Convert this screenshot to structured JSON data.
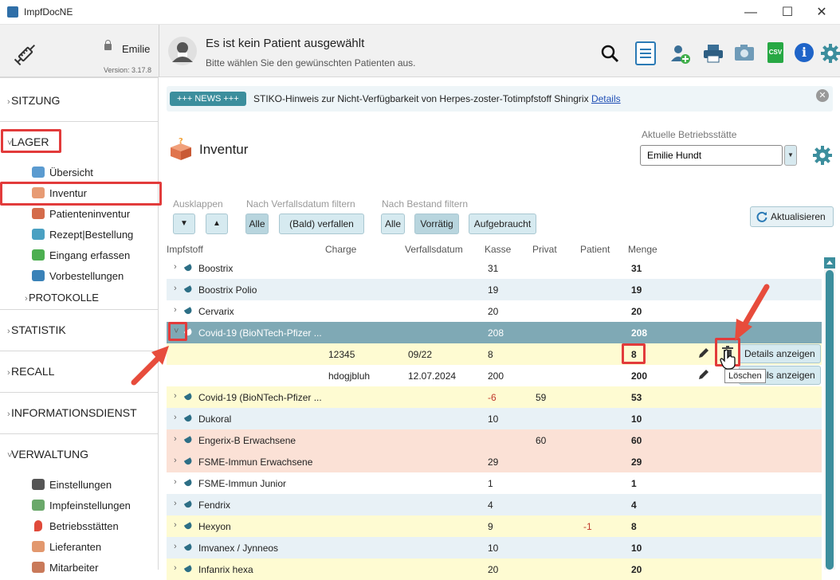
{
  "window": {
    "title": "ImpfDocNE",
    "minimize": "—",
    "maximize": "☐",
    "close": "✕"
  },
  "header": {
    "user": "Emilie",
    "version": "Version: 3.17.8",
    "patient_title": "Es ist kein Patient ausgewählt",
    "patient_subtitle": "Bitte wählen Sie den gewünschten Patienten aus.",
    "icons": [
      "search-icon",
      "document-icon",
      "add-patient-icon",
      "printer-icon",
      "camera-icon",
      "csv-icon",
      "info-icon",
      "gear-icon"
    ],
    "csv_label": "CSV",
    "info_label": "i"
  },
  "sidebar": {
    "sitzung": "SITZUNG",
    "lager": "LAGER",
    "lager_items": [
      "Übersicht",
      "Inventur",
      "Patienteninventur",
      "Rezept|Bestellung",
      "Eingang erfassen",
      "Vorbestellungen"
    ],
    "protokolle": "PROTOKOLLE",
    "statistik": "STATISTIK",
    "recall": "RECALL",
    "informationsdienst": "INFORMATIONSDIENST",
    "verwaltung": "VERWALTUNG",
    "verwaltung_items": [
      "Einstellungen",
      "Impfeinstellungen",
      "Betriebsstätten",
      "Lieferanten",
      "Mitarbeiter"
    ]
  },
  "news": {
    "badge": "+++ NEWS +++",
    "text": "STIKO-Hinweis zur Nicht-Verfügbarkeit von Herpes-zoster-Totimpfstoff Shingrix",
    "link": "Details",
    "close": "✕"
  },
  "page": {
    "title": "Inventur",
    "betriebsstaette_label": "Aktuelle Betriebsstätte",
    "betriebsstaette_value": "Emilie Hundt"
  },
  "filters": {
    "ausklappen": "Ausklappen",
    "verfall_label": "Nach Verfallsdatum filtern",
    "verfall_alle": "Alle",
    "verfall_bald": "(Bald) verfallen",
    "bestand_label": "Nach Bestand filtern",
    "bestand_alle": "Alle",
    "bestand_vorraetig": "Vorrätig",
    "bestand_aufgebraucht": "Aufgebraucht",
    "refresh": "Aktualisieren"
  },
  "columns": {
    "impfstoff": "Impfstoff",
    "charge": "Charge",
    "verfall": "Verfallsdatum",
    "kasse": "Kasse",
    "privat": "Privat",
    "patient": "Patient",
    "menge": "Menge"
  },
  "rows": [
    {
      "name": "Boostrix",
      "kasse": "31",
      "privat": "",
      "patient": "",
      "menge": "31",
      "bg": "#ffffff"
    },
    {
      "name": "Boostrix Polio",
      "kasse": "19",
      "privat": "",
      "patient": "",
      "menge": "19",
      "bg": "#e8f1f6"
    },
    {
      "name": "Cervarix",
      "kasse": "20",
      "privat": "",
      "patient": "",
      "menge": "20",
      "bg": "#ffffff"
    },
    {
      "name": "Covid-19 (BioNTech-Pfizer ...",
      "kasse": "208",
      "privat": "",
      "patient": "",
      "menge": "208",
      "bg": "#7fa9b5",
      "expanded": true
    },
    {
      "charge": "12345",
      "verfall": "09/22",
      "kasse": "8",
      "menge": "8",
      "bg": "#fefbd2",
      "sub": true,
      "details": "Details anzeigen"
    },
    {
      "charge": "hdogjbluh",
      "verfall": "12.07.2024",
      "kasse": "200",
      "menge": "200",
      "bg": "#ffffff",
      "sub": true,
      "details": "Details anzeigen"
    },
    {
      "name": "Covid-19 (BioNTech-Pfizer ...",
      "kasse": "-6",
      "privat": "59",
      "patient": "",
      "menge": "53",
      "bg": "#fefbd2"
    },
    {
      "name": "Dukoral",
      "kasse": "10",
      "privat": "",
      "patient": "",
      "menge": "10",
      "bg": "#e8f1f6"
    },
    {
      "name": "Engerix-B Erwachsene",
      "kasse": "",
      "privat": "60",
      "patient": "",
      "menge": "60",
      "bg": "#fbe1d6"
    },
    {
      "name": "FSME-Immun Erwachsene",
      "kasse": "29",
      "privat": "",
      "patient": "",
      "menge": "29",
      "bg": "#fbe1d6"
    },
    {
      "name": "FSME-Immun Junior",
      "kasse": "1",
      "privat": "",
      "patient": "",
      "menge": "1",
      "bg": "#ffffff"
    },
    {
      "name": "Fendrix",
      "kasse": "4",
      "privat": "",
      "patient": "",
      "menge": "4",
      "bg": "#e8f1f6"
    },
    {
      "name": "Hexyon",
      "kasse": "9",
      "privat": "",
      "patient": "-1",
      "menge": "8",
      "bg": "#fefbd2"
    },
    {
      "name": "Imvanex / Jynneos",
      "kasse": "10",
      "privat": "",
      "patient": "",
      "menge": "10",
      "bg": "#e8f1f6"
    },
    {
      "name": "Infanrix hexa",
      "kasse": "20",
      "privat": "",
      "patient": "",
      "menge": "20",
      "bg": "#fefbd2"
    }
  ],
  "tooltip": "Löschen"
}
